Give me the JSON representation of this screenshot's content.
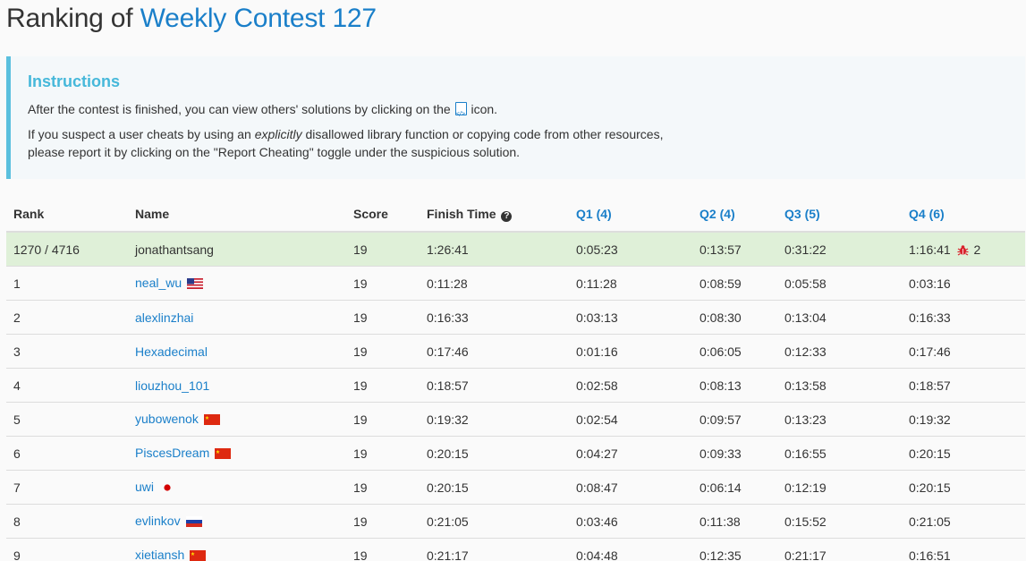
{
  "title": {
    "prefix": "Ranking of",
    "contest": "Weekly Contest 127"
  },
  "instructions": {
    "heading": "Instructions",
    "line1_before": "After the contest is finished, you can view others' solutions by clicking on the",
    "line1_after": "icon.",
    "line2_before": "If you suspect a user cheats by using an",
    "line2_em": "explicitly",
    "line2_after": "disallowed library function or copying code from other resources,",
    "line3": "please report it by clicking on the \"Report Cheating\" toggle under the suspicious solution."
  },
  "table": {
    "headers": {
      "rank": "Rank",
      "name": "Name",
      "score": "Score",
      "finish": "Finish Time",
      "q1": "Q1 (4)",
      "q2": "Q2 (4)",
      "q3": "Q3 (5)",
      "q4": "Q4 (6)"
    },
    "self": {
      "rank": "1270 / 4716",
      "name": "jonathantsang",
      "score": "19",
      "finish": "1:26:41",
      "q1": "0:05:23",
      "q2": "0:13:57",
      "q3": "0:31:22",
      "q4": "1:16:41",
      "q4_bugs": "2"
    },
    "rows": [
      {
        "rank": "1",
        "name": "neal_wu",
        "flag": "us",
        "score": "19",
        "finish": "0:11:28",
        "q1": "0:11:28",
        "q2": "0:08:59",
        "q3": "0:05:58",
        "q4": "0:03:16"
      },
      {
        "rank": "2",
        "name": "alexlinzhai",
        "flag": "",
        "score": "19",
        "finish": "0:16:33",
        "q1": "0:03:13",
        "q2": "0:08:30",
        "q3": "0:13:04",
        "q4": "0:16:33"
      },
      {
        "rank": "3",
        "name": "Hexadecimal",
        "flag": "",
        "score": "19",
        "finish": "0:17:46",
        "q1": "0:01:16",
        "q2": "0:06:05",
        "q3": "0:12:33",
        "q4": "0:17:46"
      },
      {
        "rank": "4",
        "name": "liouzhou_101",
        "flag": "",
        "score": "19",
        "finish": "0:18:57",
        "q1": "0:02:58",
        "q2": "0:08:13",
        "q3": "0:13:58",
        "q4": "0:18:57"
      },
      {
        "rank": "5",
        "name": "yubowenok",
        "flag": "cn",
        "score": "19",
        "finish": "0:19:32",
        "q1": "0:02:54",
        "q2": "0:09:57",
        "q3": "0:13:23",
        "q4": "0:19:32"
      },
      {
        "rank": "6",
        "name": "PiscesDream",
        "flag": "cn",
        "score": "19",
        "finish": "0:20:15",
        "q1": "0:04:27",
        "q2": "0:09:33",
        "q3": "0:16:55",
        "q4": "0:20:15"
      },
      {
        "rank": "7",
        "name": "uwi",
        "flag": "jp",
        "score": "19",
        "finish": "0:20:15",
        "q1": "0:08:47",
        "q2": "0:06:14",
        "q3": "0:12:19",
        "q4": "0:20:15"
      },
      {
        "rank": "8",
        "name": "evlinkov",
        "flag": "ru",
        "score": "19",
        "finish": "0:21:05",
        "q1": "0:03:46",
        "q2": "0:11:38",
        "q3": "0:15:52",
        "q4": "0:21:05"
      },
      {
        "rank": "9",
        "name": "xietiansh",
        "flag": "cn",
        "score": "19",
        "finish": "0:21:17",
        "q1": "0:04:48",
        "q2": "0:12:35",
        "q3": "0:21:17",
        "q4": "0:16:51"
      }
    ]
  },
  "colors": {
    "link": "#1a7fc9",
    "info_heading": "#46b8da",
    "info_border": "#5bc0de",
    "self_row": "#dff0d8",
    "bug": "#d9232d"
  }
}
